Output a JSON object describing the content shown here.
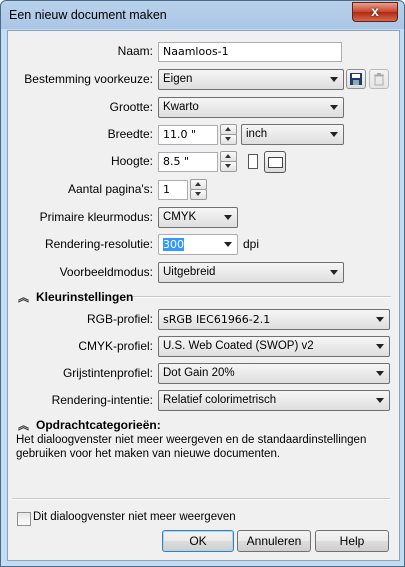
{
  "window": {
    "title": "Een nieuw document maken",
    "close_label": "x"
  },
  "fields": {
    "naam": {
      "label": "Naam:",
      "value": "Naamloos-1"
    },
    "bestemming": {
      "label": "Bestemming voorkeuze:",
      "value": "Eigen"
    },
    "grootte": {
      "label": "Grootte:",
      "value": "Kwarto"
    },
    "breedte": {
      "label": "Breedte:",
      "value": "11.0 \"",
      "unit": "inch"
    },
    "hoogte": {
      "label": "Hoogte:",
      "value": "8.5 \""
    },
    "paginas": {
      "label": "Aantal pagina's:",
      "value": "1"
    },
    "kleurmodus": {
      "label": "Primaire kleurmodus:",
      "value": "CMYK"
    },
    "resolutie": {
      "label": "Rendering-resolutie:",
      "value": "300",
      "unit": "dpi"
    },
    "voorbeeld": {
      "label": "Voorbeeldmodus:",
      "value": "Uitgebreid"
    }
  },
  "color_section": {
    "title": "Kleurinstellingen",
    "rgb": {
      "label": "RGB-profiel:",
      "value": "sRGB IEC61966-2.1"
    },
    "cmyk": {
      "label": "CMYK-profiel:",
      "value": "U.S. Web Coated (SWOP) v2"
    },
    "grijs": {
      "label": "Grijstintenprofiel:",
      "value": "Dot Gain 20%"
    },
    "intentie": {
      "label": "Rendering-intentie:",
      "value": "Relatief colorimetrisch"
    }
  },
  "category_section": {
    "title": "Opdrachtcategorieën:",
    "description": "Het dialoogvenster niet meer weergeven en de standaardinstellingen gebruiken voor het maken van nieuwe documenten."
  },
  "footer": {
    "checkbox_label": "Dit dialoogvenster niet meer weergeven",
    "checkbox_checked": false,
    "ok": "OK",
    "cancel": "Annuleren",
    "help": "Help"
  }
}
